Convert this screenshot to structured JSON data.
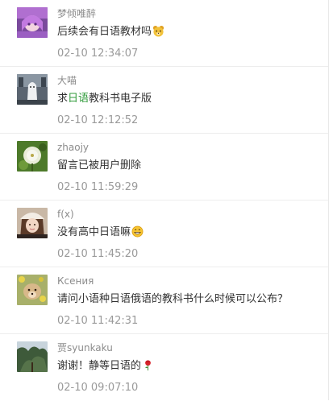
{
  "comments": [
    {
      "avatar_icon": "anime-girl-avatar",
      "username": "梦倾唯醉",
      "text": "后续会有日语教材吗",
      "emoji": "bear-face-emoji",
      "time": "02-10 12:34:07"
    },
    {
      "avatar_icon": "ghost-figure-avatar",
      "username": "大喵",
      "text_before": "求",
      "text_highlight": "日语",
      "text_after": "教科书电子版",
      "highlight_color": "#2f9a3a",
      "time": "02-10 12:12:52"
    },
    {
      "avatar_icon": "dandelion-avatar",
      "username": "zhaojy",
      "text": "留言已被用户删除",
      "time": "02-10 11:59:29"
    },
    {
      "avatar_icon": "girl-with-hat-avatar",
      "username": "f(x)",
      "text": "没有高中日语嘛",
      "emoji": "grinning-face-emoji",
      "time": "02-10 11:45:20"
    },
    {
      "avatar_icon": "dog-with-flowers-avatar",
      "username": "Ксения",
      "text": "请问小语种日语俄语的教科书什么时候可以公布？",
      "time": "02-10 11:42:31"
    },
    {
      "avatar_icon": "tree-sky-avatar",
      "username": "贾syunkaku",
      "text": "谢谢！静等日语的",
      "emoji": "rose-emoji",
      "time": "02-10 09:07:10"
    }
  ],
  "colors": {
    "username": "#8c8c8c",
    "text": "#333333",
    "time": "#9a9a9a",
    "divider": "#ededed",
    "highlight": "#2f9a3a"
  }
}
